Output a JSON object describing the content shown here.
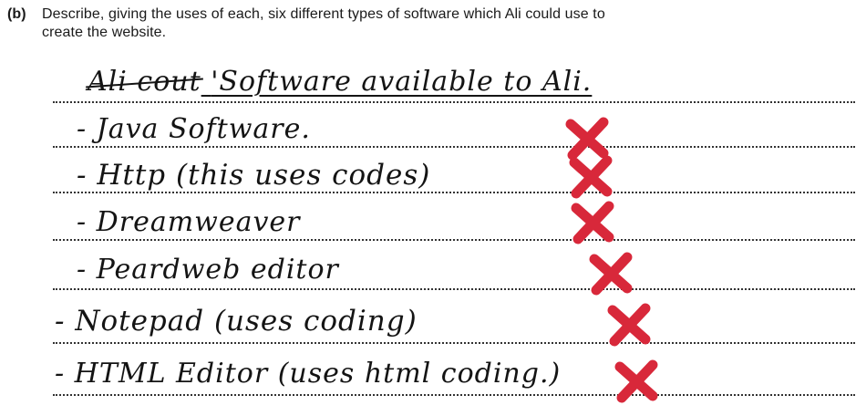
{
  "question": {
    "number": "(b)",
    "line1": "Describe, giving the uses of each, six different types of software which Ali could use to",
    "line2": "create the website."
  },
  "answer": {
    "heading_struck": "Ali cout",
    "heading": "'Software available to Ali.",
    "lines": [
      "- Java Software.",
      "- Http (this uses codes)",
      "- Dreamweaver",
      "- Peardweb editor",
      "- Notepad (uses coding)",
      "- HTML Editor (uses html coding.)"
    ]
  },
  "marks": {
    "cross_color": "#d8283a",
    "cross_icon": "cross-mark-icon"
  }
}
